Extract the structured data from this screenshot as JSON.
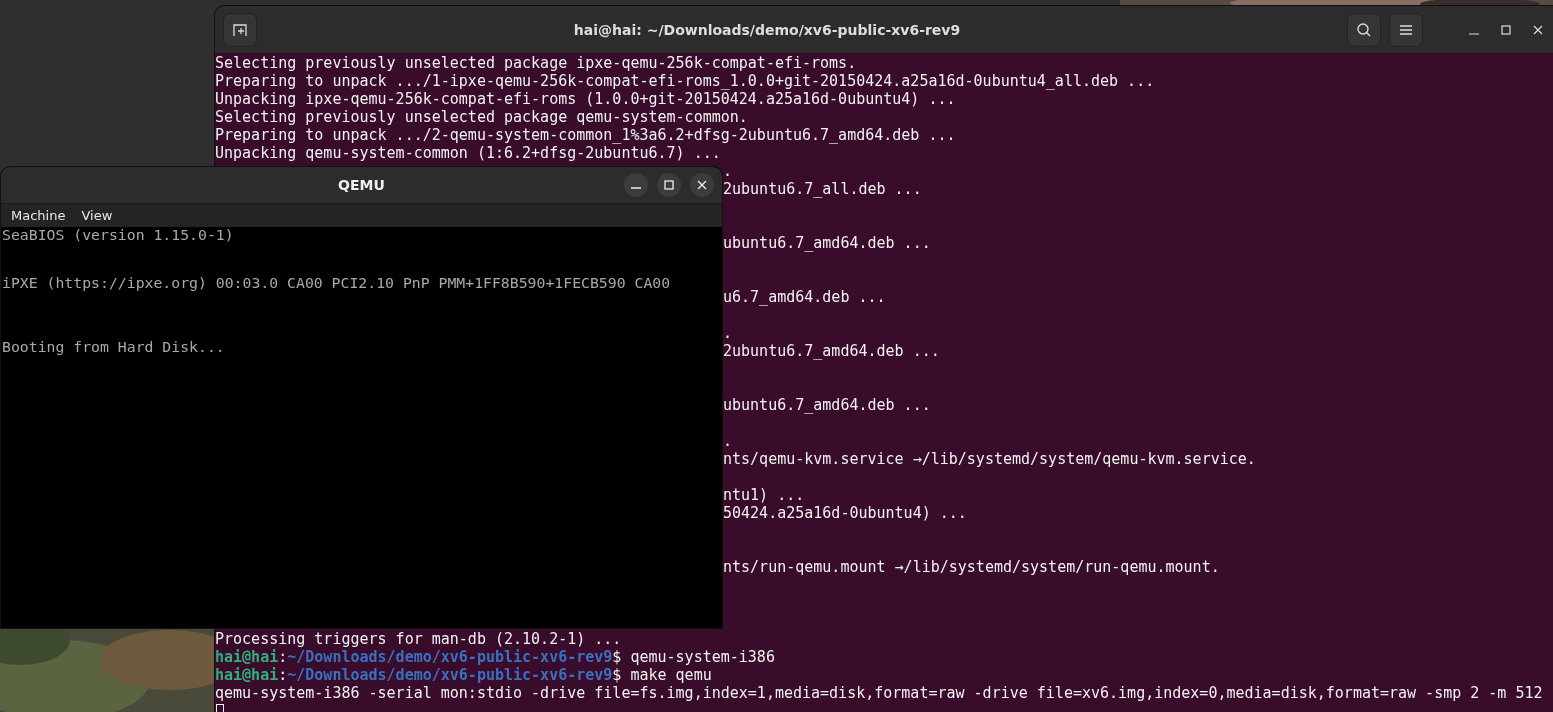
{
  "terminal": {
    "title": "hai@hai: ~/Downloads/demo/xv6-public-xv6-rev9",
    "lines": [
      {
        "kind": "text",
        "text": "Selecting previously unselected package ipxe-qemu-256k-compat-efi-roms."
      },
      {
        "kind": "text",
        "text": "Preparing to unpack .../1-ipxe-qemu-256k-compat-efi-roms_1.0.0+git-20150424.a25a16d-0ubuntu4_all.deb ..."
      },
      {
        "kind": "text",
        "text": "Unpacking ipxe-qemu-256k-compat-efi-roms (1.0.0+git-20150424.a25a16d-0ubuntu4) ..."
      },
      {
        "kind": "text",
        "text": "Selecting previously unselected package qemu-system-common."
      },
      {
        "kind": "text",
        "text": "Preparing to unpack .../2-qemu-system-common_1%3a6.2+dfsg-2ubuntu6.7_amd64.deb ..."
      },
      {
        "kind": "text",
        "text": "Unpacking qemu-system-common (1:6.2+dfsg-2ubuntu6.7) ..."
      },
      {
        "kind": "covered",
        "text": "."
      },
      {
        "kind": "covered",
        "text": "2ubuntu6.7_all.deb ..."
      },
      {
        "kind": "hidden"
      },
      {
        "kind": "hidden"
      },
      {
        "kind": "covered",
        "text": "ubuntu6.7_amd64.deb ..."
      },
      {
        "kind": "hidden"
      },
      {
        "kind": "hidden"
      },
      {
        "kind": "covered",
        "text": "u6.7_amd64.deb ..."
      },
      {
        "kind": "hidden"
      },
      {
        "kind": "covered",
        "text": "."
      },
      {
        "kind": "covered",
        "text": "2ubuntu6.7_amd64.deb ..."
      },
      {
        "kind": "hidden"
      },
      {
        "kind": "hidden"
      },
      {
        "kind": "covered",
        "text": "ubuntu6.7_amd64.deb ..."
      },
      {
        "kind": "hidden"
      },
      {
        "kind": "covered",
        "text": "."
      },
      {
        "kind": "covered",
        "text": "nts/qemu-kvm.service →/lib/systemd/system/qemu-kvm.service."
      },
      {
        "kind": "hidden"
      },
      {
        "kind": "covered",
        "text": "ntu1) ..."
      },
      {
        "kind": "covered",
        "text": "50424.a25a16d-0ubuntu4) ..."
      },
      {
        "kind": "hidden"
      },
      {
        "kind": "hidden"
      },
      {
        "kind": "covered",
        "text": "nts/run-qemu.mount →/lib/systemd/system/run-qemu.mount."
      },
      {
        "kind": "hidden"
      },
      {
        "kind": "hidden"
      },
      {
        "kind": "hidden"
      },
      {
        "kind": "text",
        "text": "Processing triggers for man-db (2.10.2-1) ..."
      },
      {
        "kind": "prompt",
        "user": "hai@hai",
        "separator": ":",
        "path": "~/Downloads/demo/xv6-public-xv6-rev9",
        "symbol": "$",
        "command": "qemu-system-i386"
      },
      {
        "kind": "prompt",
        "user": "hai@hai",
        "separator": ":",
        "path": "~/Downloads/demo/xv6-public-xv6-rev9",
        "symbol": "$",
        "command": "make qemu"
      },
      {
        "kind": "text",
        "text": "qemu-system-i386 -serial mon:stdio -drive file=fs.img,index=1,media=disk,format=raw -drive file=xv6.img,index=0,media=disk,format=raw -smp 2 -m 512"
      },
      {
        "kind": "cursor"
      }
    ]
  },
  "qemu": {
    "title": "QEMU",
    "menu": [
      "Machine",
      "View"
    ],
    "screen": [
      "SeaBIOS (version 1.15.0-1)",
      "iPXE (https://ipxe.org) 00:03.0 CA00 PCI2.10 PnP PMM+1FF8B590+1FECB590 CA00",
      "Booting from Hard Disk..."
    ]
  }
}
